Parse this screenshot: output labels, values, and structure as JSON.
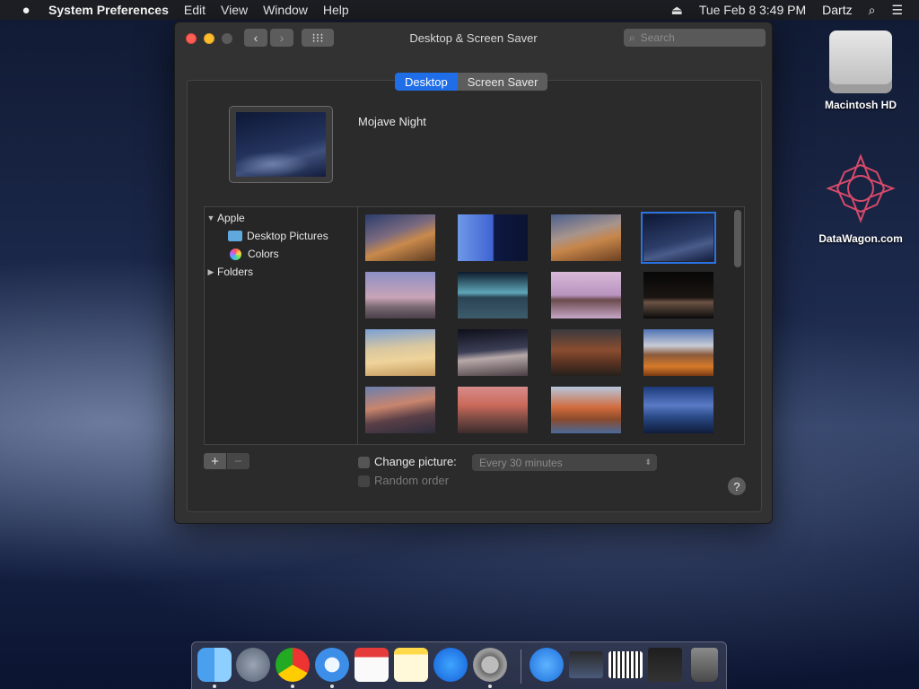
{
  "menubar": {
    "apple_icon": "",
    "app_name": "System Preferences",
    "menus": [
      "Edit",
      "View",
      "Window",
      "Help"
    ],
    "date_time": "Tue Feb 8  3:49 PM",
    "user": "Dartz"
  },
  "window": {
    "title": "Desktop & Screen Saver",
    "search_placeholder": "Search",
    "tabs": [
      "Desktop",
      "Screen Saver"
    ],
    "active_tab": "Desktop",
    "current_picture": "Mojave Night",
    "sidebar": {
      "apple": "Apple",
      "desktop_pictures": "Desktop Pictures",
      "colors": "Colors",
      "folders": "Folders"
    },
    "add_label": "+",
    "remove_label": "−",
    "change_picture_label": "Change picture:",
    "interval_value": "Every 30 minutes",
    "random_order_label": "Random order",
    "help_label": "?"
  },
  "desktop_icons": [
    {
      "label": "Macintosh HD"
    },
    {
      "label": "DataWagon.com"
    }
  ]
}
